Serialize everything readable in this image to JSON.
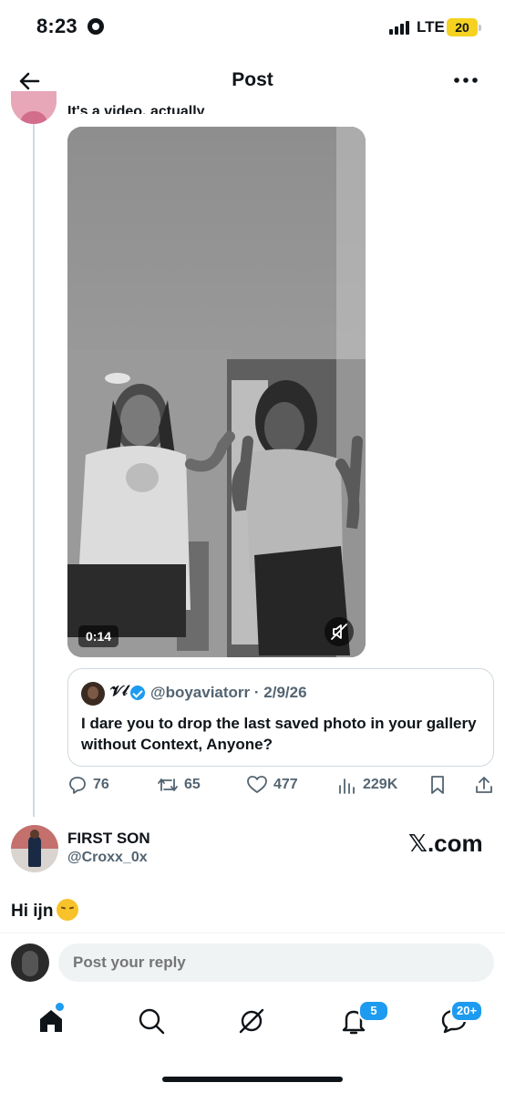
{
  "status_bar": {
    "time": "8:23",
    "network": "LTE",
    "battery": "20"
  },
  "header": {
    "title": "Post"
  },
  "parent_post": {
    "text": "It's a video, actually",
    "video": {
      "duration": "0:14"
    },
    "quoted_post": {
      "name": "𝓥𝓁",
      "handle": "@boyaviatorr",
      "date": "2/9/26",
      "text": "I dare you to drop the last saved photo in your gallery without Context, Anyone?"
    },
    "stats": {
      "replies": "76",
      "reposts": "65",
      "likes": "477",
      "views": "229K"
    }
  },
  "reply": {
    "name": "FIRST SON",
    "handle": "@Croxx_0x",
    "source_link": "𝕏.com",
    "text": "Hi ijn"
  },
  "composer": {
    "placeholder": "Post your reply"
  },
  "bottom_nav": {
    "notifications_badge": "5",
    "messages_badge": "20+"
  },
  "colors": {
    "accent": "#1d9bf0",
    "text_primary": "#0f1419",
    "text_secondary": "#536471",
    "border": "#cfd9de"
  }
}
